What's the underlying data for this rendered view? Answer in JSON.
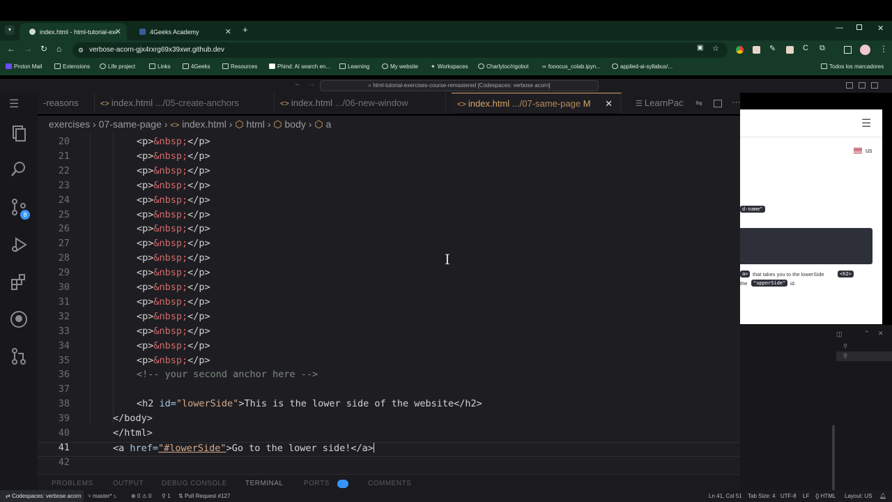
{
  "browser": {
    "tabs": [
      {
        "label": "index.html - html-tutorial-exe",
        "active": true
      },
      {
        "label": "4Geeks Academy",
        "active": false
      }
    ],
    "url": "verbose-acorn-gjx4rxrg69x39xwr.github.dev",
    "bookmarks": [
      "Proton Mail",
      "Extensions",
      "Life project",
      "Links",
      "4Geeks",
      "Resources",
      "Phind: AI search en...",
      "Learning",
      "My website",
      "Workspaces",
      "Charlytoc/rigobot",
      "fooocus_colab.ipyn...",
      "applied-ai-syllabus/..."
    ],
    "all_bookmarks": "Todos los marcadores"
  },
  "codespace": {
    "command_center": "html-tutorial-exercises-course-remastered [Codespaces: verbose acorn]"
  },
  "editor": {
    "tabs": [
      {
        "name": "-reasons",
        "path": "",
        "active": false
      },
      {
        "name": "index.html",
        "path": ".../05-create-anchors",
        "active": false
      },
      {
        "name": "index.html",
        "path": ".../06-new-window",
        "active": false
      },
      {
        "name": "index.html",
        "path": ".../07-same-page",
        "active": true,
        "badge": "M"
      },
      {
        "name": "LearnPac",
        "path": "",
        "active": false
      }
    ],
    "breadcrumb": [
      "exercises",
      "07-same-page",
      "index.html",
      "html",
      "body",
      "a"
    ],
    "lines": {
      "p_open": "<p>",
      "p_entity": "&nbsp;",
      "p_close": "</p>",
      "comment": "<!-- your second anchor here -->",
      "h2_open": "<h2 ",
      "h2_attr": "id=",
      "h2_value": "\"lowerSide\"",
      "h2_text": ">This is the lower side of the website</h2>",
      "body_close": "</body>",
      "html_close": "</html>",
      "a_open": "<a ",
      "a_attr": "href=",
      "a_value": "\"#lowerSide\"",
      "a_text": ">Go to the lower side!</a>"
    },
    "line_numbers": [
      "20",
      "21",
      "22",
      "23",
      "24",
      "25",
      "26",
      "27",
      "28",
      "29",
      "30",
      "31",
      "32",
      "33",
      "34",
      "35",
      "36",
      "37",
      "38",
      "39",
      "40",
      "41",
      "42"
    ],
    "current_line": "41",
    "panel_tabs": [
      "PROBLEMS",
      "OUTPUT",
      "DEBUG CONSOLE",
      "TERMINAL",
      "PORTS",
      "COMMENTS"
    ]
  },
  "preview": {
    "lang": "us",
    "chip1": "d-name\"",
    "text1": "that takes you to the lowerSide",
    "chip_a": "a>",
    "chip_h2": "<h2>",
    "text2_pre": "the",
    "chip_upper": "\"upperSide\"",
    "text2_post": "id."
  },
  "statusbar": {
    "remote": "Codespaces: verbose acorn",
    "branch": "master*",
    "problems": "0 ⚠ 0",
    "ports": "1",
    "pr": "Pull Request #127",
    "position": "Ln 41, Col 51",
    "tab_size": "Tab Size: 4",
    "encoding": "UTF-8",
    "eol": "LF",
    "language": "HTML",
    "layout": "Layout: US"
  },
  "colors": {
    "accent_tab": "#d8a566",
    "browser_green": "#153a28",
    "badge_blue": "#3794ff"
  }
}
